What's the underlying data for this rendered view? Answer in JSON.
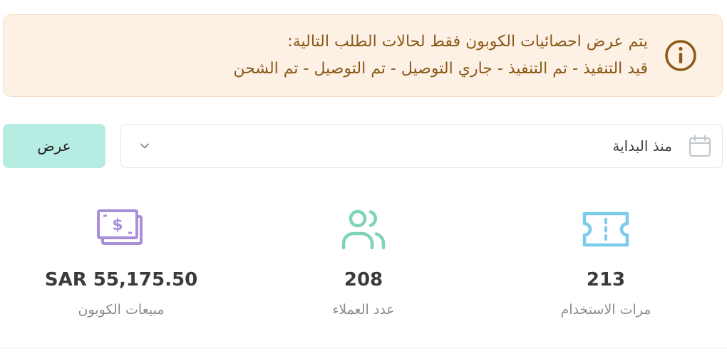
{
  "alert": {
    "icon": "info-icon",
    "color": "#8a5a17",
    "background": "#fdf1e6",
    "line1": "يتم عرض احصائيات الكوبون فقط لحالات الطلب التالية:",
    "line2": "قيد التنفيذ - تم التنفيذ - جاري التوصيل - تم التوصيل - تم الشحن"
  },
  "filter": {
    "period_value": "منذ البداية",
    "period_icon": "calendar-icon",
    "dropdown_icon": "chevron-down-icon",
    "show_button": "عرض",
    "show_button_color": "#b6ece2"
  },
  "stats": [
    {
      "icon": "ticket-icon",
      "icon_color": "#7ccbeb",
      "value": "213",
      "label": "مرات الاستخدام"
    },
    {
      "icon": "users-icon",
      "icon_color": "#7fd3bb",
      "value": "208",
      "label": "عدد العملاء"
    },
    {
      "icon": "money-icon",
      "icon_color": "#a98fd8",
      "value": "SAR 55,175.50",
      "label": "مبيعات الكوبون"
    }
  ]
}
